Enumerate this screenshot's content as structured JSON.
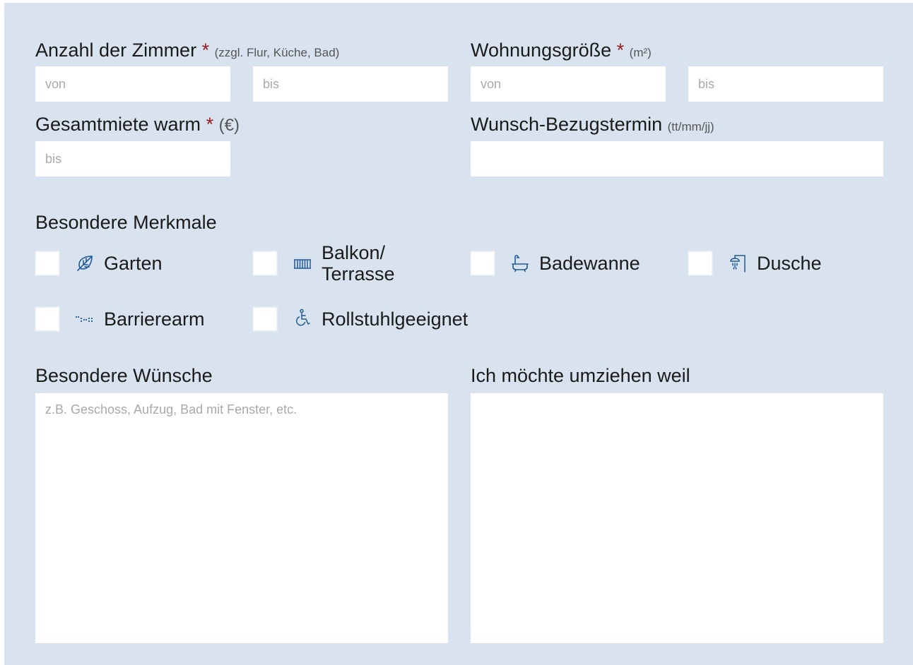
{
  "rooms": {
    "label": "Anzahl der Zimmer",
    "required_mark": "*",
    "hint": "(zzgl. Flur, Küche, Bad)",
    "from_placeholder": "von",
    "to_placeholder": "bis"
  },
  "size": {
    "label": "Wohnungsgröße",
    "required_mark": "*",
    "hint": "(m²)",
    "from_placeholder": "von",
    "to_placeholder": "bis"
  },
  "rent": {
    "label": "Gesamtmiete warm",
    "required_mark": "*",
    "hint": "(€)",
    "to_placeholder": "bis"
  },
  "move_date": {
    "label": "Wunsch-Bezugstermin",
    "hint": "(tt/mm/jj)",
    "value": ""
  },
  "features": {
    "title": "Besondere Merkmale",
    "items": [
      {
        "label": "Garten",
        "icon": "leaf-icon",
        "checked": false
      },
      {
        "label_line1": "Balkon/",
        "label_line2": "Terrasse",
        "icon": "balcony-railing-icon",
        "checked": false
      },
      {
        "label": "Badewanne",
        "icon": "bathtub-icon",
        "checked": false
      },
      {
        "label": "Dusche",
        "icon": "shower-icon",
        "checked": false
      },
      {
        "label": "Barrierearm",
        "icon": "barrier-free-icon",
        "checked": false
      },
      {
        "label": "Rollstuhlgeeignet",
        "icon": "wheelchair-icon",
        "checked": false
      }
    ]
  },
  "wishes": {
    "label": "Besondere Wünsche",
    "placeholder": "z.B. Geschoss, Aufzug, Bad mit Fenster, etc."
  },
  "reason": {
    "label": "Ich möchte umziehen weil",
    "placeholder": ""
  },
  "colors": {
    "panel_bg": "#d9e3ef",
    "required_mark": "#9b1b1b",
    "icon_blue": "#1f5a9a",
    "placeholder": "#a9a9a9"
  }
}
